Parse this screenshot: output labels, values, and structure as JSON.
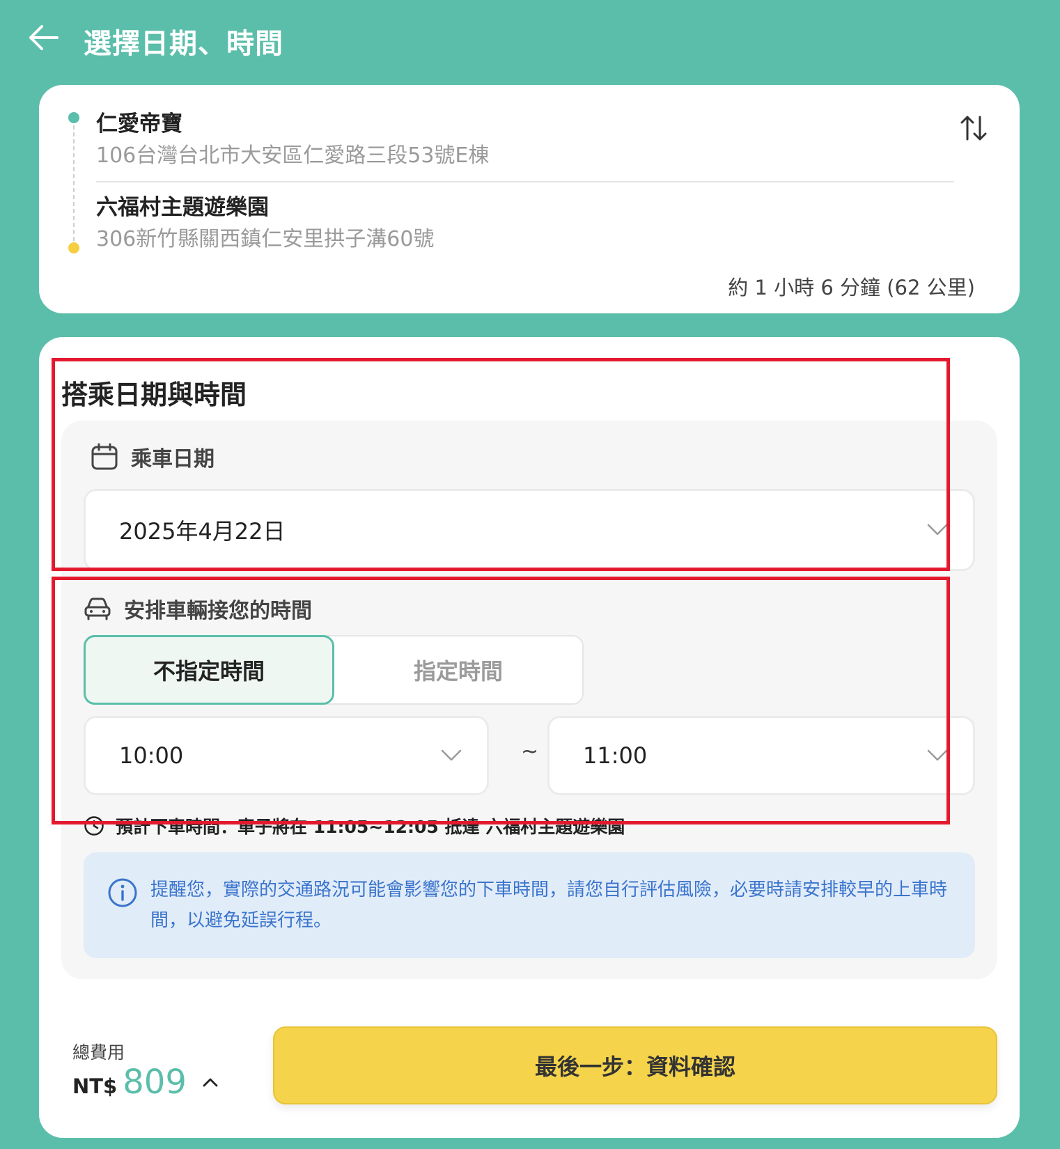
{
  "header": {
    "title": "選擇日期、時間"
  },
  "route": {
    "origin": {
      "name": "仁愛帝寶",
      "address": "106台灣台北市大安區仁愛路三段53號E棟"
    },
    "destination": {
      "name": "六福村主題遊樂園",
      "address": "306新竹縣關西鎮仁安里拱子溝60號"
    },
    "summary": "約 1 小時 6 分鐘 (62 公里)"
  },
  "ride": {
    "section_title": "搭乘日期與時間",
    "date_label": "乘車日期",
    "date_value": "2025年4月22日",
    "pickup_label": "安排車輛接您的時間",
    "time_modes": [
      "不指定時間",
      "指定時間"
    ],
    "time_start": "10:00",
    "time_separator": "~",
    "time_end": "11:00",
    "estimate": "預計下車時間：車子將在 11:05~12:05 抵達 六福村主題遊樂園"
  },
  "notice": {
    "text": "提醒您，實際的交通路況可能會影響您的下車時間，請您自行評估風險，必要時請安排較早的上車時間，以避免延誤行程。"
  },
  "footer": {
    "total_label": "總費用",
    "currency": "NT$",
    "amount": "809",
    "cta": "最後一步：資料確認"
  },
  "colors": {
    "brand": "#5bbeaa",
    "accent": "#f5d44c",
    "highlight": "#e3192e",
    "notice": "#3a74cc"
  },
  "icons": [
    "back-arrow-icon",
    "swap-icon",
    "calendar-icon",
    "car-icon",
    "chevron-down-icon",
    "clock-icon",
    "info-icon",
    "chevron-up-icon"
  ]
}
